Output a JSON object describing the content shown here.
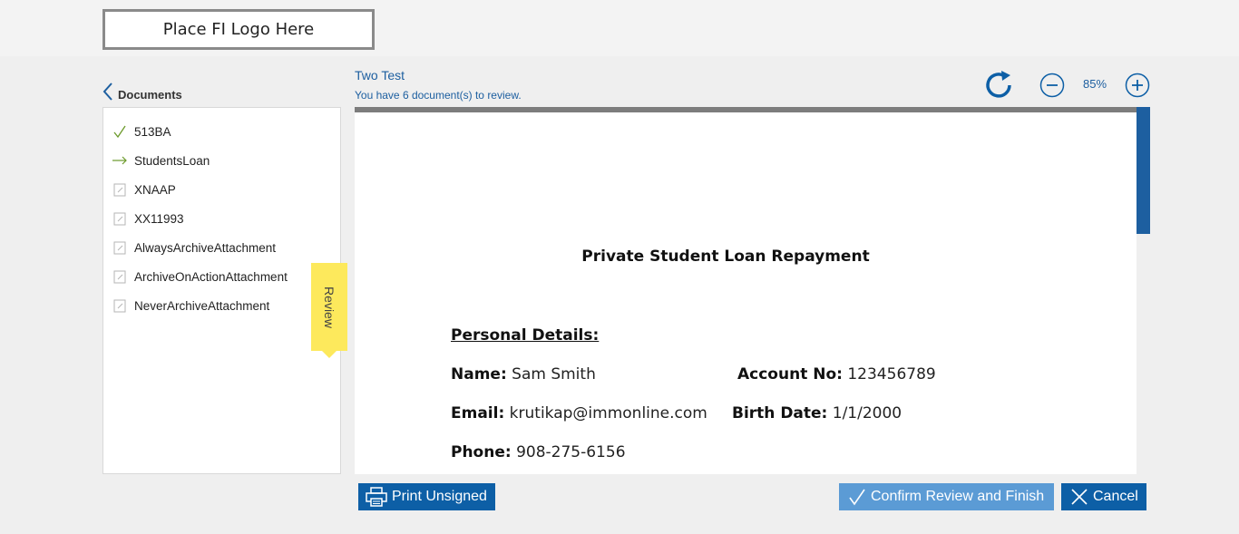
{
  "header": {
    "logo_text": "Place FI Logo Here"
  },
  "sidebar": {
    "title": "Documents",
    "items": [
      {
        "label": "513BA",
        "status": "complete-check-icon"
      },
      {
        "label": "StudentsLoan",
        "status": "current-arrow-icon"
      },
      {
        "label": "XNAAP",
        "status": "document-icon"
      },
      {
        "label": "XX11993",
        "status": "document-icon"
      },
      {
        "label": "AlwaysArchiveAttachment",
        "status": "document-icon"
      },
      {
        "label": "ArchiveOnActionAttachment",
        "status": "document-icon"
      },
      {
        "label": "NeverArchiveAttachment",
        "status": "document-icon"
      }
    ],
    "review_tab_label": "Review"
  },
  "viewer": {
    "document_name": "Two Test",
    "review_count_text": "You have 6 document(s) to review.",
    "zoom_level": "85%",
    "page": {
      "title": "Private Student Loan Repayment",
      "section_heading": "Personal Details:",
      "fields": {
        "name_label": "Name:",
        "name_value": "Sam Smith",
        "account_label": "Account No:",
        "account_value": "123456789",
        "email_label": "Email:",
        "email_value": "krutikap@immonline.com",
        "birth_label": "Birth Date:",
        "birth_value": "1/1/2000",
        "phone_label": "Phone:",
        "phone_value": "908-275-6156"
      }
    }
  },
  "actions": {
    "print_label": "Print Unsigned",
    "confirm_label": "Confirm Review and Finish",
    "cancel_label": "Cancel"
  },
  "colors": {
    "primary": "#0d5fa6",
    "confirm": "#5b9bd5",
    "review_tab": "#fde95c",
    "link_text": "#1d5fa0",
    "check_green": "#6b9a2a"
  }
}
